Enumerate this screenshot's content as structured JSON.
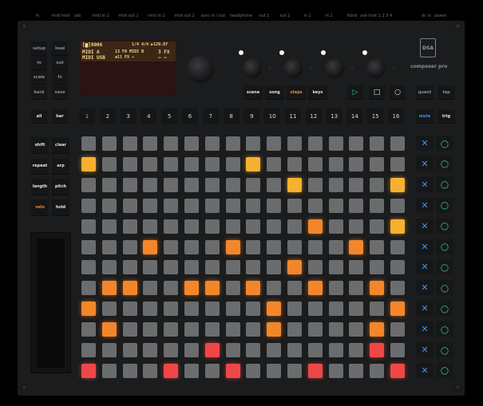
{
  "top_labels": [
    "fs",
    "midi host",
    "usb",
    "midi in 1",
    "midi out 1",
    "midi in 2",
    "midi out 2",
    "sync in / out",
    "headphone",
    "out 1",
    "out 2",
    "in 1",
    "in 2",
    "fsbrd",
    "usb host 1 2 3 4",
    "dc in",
    "power"
  ],
  "brand": {
    "logo_text": "DSA",
    "name": "composer pro"
  },
  "left_buttons": [
    [
      "setup",
      "load"
    ],
    [
      "in",
      "out"
    ],
    [
      "scale",
      "fx"
    ],
    [
      "back",
      "save"
    ]
  ],
  "all_bar": [
    "all",
    "bar"
  ],
  "display": {
    "row1_left": "[▆]8006",
    "row1_right": "1/4 4/4 ▶120.87",
    "row2_left": "MIDI A",
    "row2_mid": "13 F8 MIDI B",
    "row2_right": "3 FX",
    "row3_left": "MIDI USB",
    "row3_mid": "all FX —",
    "row3_right": "— —"
  },
  "mode_buttons": [
    "scene",
    "song",
    "steps",
    "keys"
  ],
  "transport": {
    "play": "▷",
    "stop": "□",
    "record": "○"
  },
  "right_top_buttons": [
    "quant",
    "tap"
  ],
  "step_numbers": [
    "1",
    "2",
    "3",
    "4",
    "5",
    "6",
    "7",
    "8",
    "9",
    "10",
    "11",
    "12",
    "13",
    "14",
    "15",
    "16"
  ],
  "right_mode_buttons": [
    "mute",
    "trig"
  ],
  "function_buttons": [
    [
      "shift",
      "clear"
    ],
    [
      "repeat",
      "arp"
    ],
    [
      "length",
      "pitch"
    ],
    [
      "velo",
      "hold"
    ]
  ],
  "pad_grid": [
    "................",
    "y.......y.......",
    "..........y....y",
    "................",
    "...........o...y",
    "...o...o.....o..",
    "..........o.....",
    ".oo..oo.o..o..o.",
    "o........o.....o",
    ".o.......o....o.",
    "......r.......r.",
    "r...r..r...r...r"
  ],
  "track_icons": {
    "mute": "✕",
    "trig": "○"
  },
  "colors": {
    "accent_orange": "#f08a2c",
    "mute_blue": "#4a90e2",
    "trig_green": "#35c77a"
  }
}
